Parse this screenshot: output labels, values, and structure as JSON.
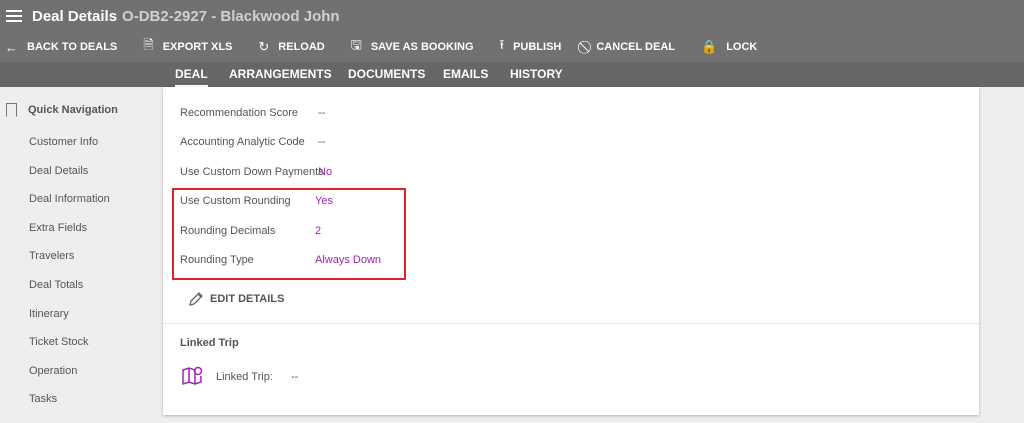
{
  "header": {
    "title": "Deal Details",
    "subtitle": "O-DB2-2927 - Blackwood John"
  },
  "toolbar": [
    {
      "icon": "arrow-left-icon",
      "glyph": "←",
      "label": "BACK TO DEALS"
    },
    {
      "icon": "excel-file-icon",
      "glyph": "🗎",
      "label": "EXPORT XLS"
    },
    {
      "icon": "reload-icon",
      "glyph": "↻",
      "label": "RELOAD"
    },
    {
      "icon": "save-icon",
      "glyph": "🖫",
      "label": "SAVE AS BOOKING"
    },
    {
      "icon": "upload-icon",
      "glyph": "⭱",
      "label": "PUBLISH"
    },
    {
      "icon": "cancel-icon",
      "glyph": "⃠",
      "label": "CANCEL DEAL"
    },
    {
      "icon": "lock-icon",
      "glyph": "🔒",
      "label": "LOCK"
    }
  ],
  "tabs": [
    "DEAL",
    "ARRANGEMENTS",
    "DOCUMENTS",
    "EMAILS",
    "HISTORY"
  ],
  "active_tab": "DEAL",
  "sidebar": {
    "title": "Quick Navigation",
    "items": [
      "Customer Info",
      "Deal Details",
      "Deal Information",
      "Extra Fields",
      "Travelers",
      "Deal Totals",
      "Itinerary",
      "Ticket Stock",
      "Operation",
      "Tasks"
    ]
  },
  "fields": [
    {
      "label": "Recommendation Score",
      "value": "--"
    },
    {
      "label": "Accounting Analytic Code",
      "value": "--"
    },
    {
      "label": "Use Custom Down Payments",
      "value": "No"
    },
    {
      "label": "Use Custom Rounding",
      "value": "Yes"
    },
    {
      "label": "Rounding Decimals",
      "value": "2"
    },
    {
      "label": "Rounding Type",
      "value": "Always Down"
    }
  ],
  "edit_label": "EDIT DETAILS",
  "linked_trip": {
    "title": "Linked Trip",
    "label": "Linked Trip:",
    "value": "--"
  },
  "colors": {
    "accent": "#9c27b0",
    "highlight": "#e32227"
  }
}
